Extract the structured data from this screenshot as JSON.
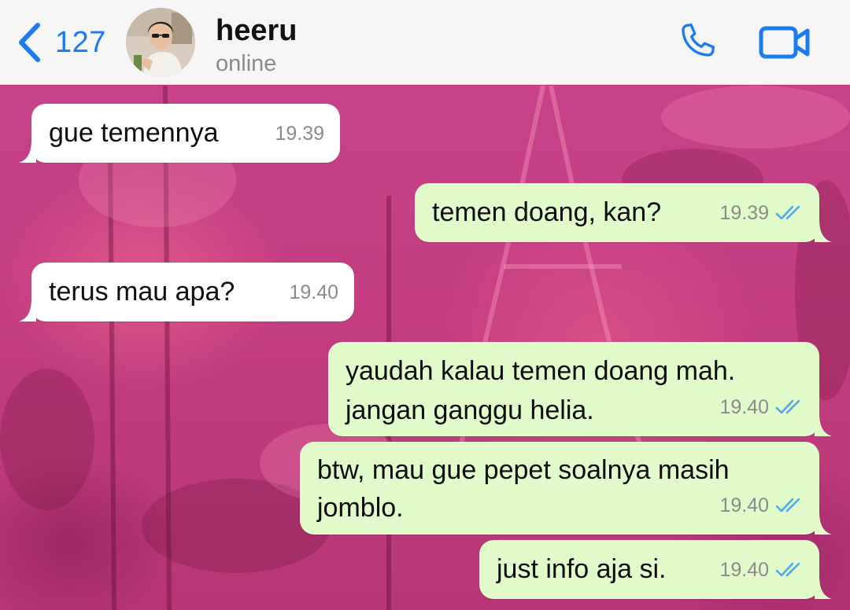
{
  "header": {
    "back_count": "127",
    "contact_name": "heeru",
    "contact_status": "online",
    "call_icon": "phone-icon",
    "video_icon": "video-camera-icon"
  },
  "messages": [
    {
      "direction": "incoming",
      "text": "gue temennya",
      "time": "19.39"
    },
    {
      "direction": "outgoing",
      "text": "temen doang, kan?",
      "time": "19.39",
      "status": "read"
    },
    {
      "direction": "incoming",
      "text": "terus mau apa?",
      "time": "19.40"
    },
    {
      "direction": "outgoing",
      "text": "yaudah kalau temen doang mah. jangan ganggu helia.",
      "time": "19.40",
      "status": "read"
    },
    {
      "direction": "outgoing",
      "text": "btw, mau gue pepet soalnya masih jomblo.",
      "time": "19.40",
      "status": "read"
    },
    {
      "direction": "outgoing",
      "text": "just info aja si.",
      "time": "19.40",
      "status": "read"
    }
  ],
  "colors": {
    "accent": "#1a7cf0",
    "outgoing_bubble": "#e2fbcb",
    "incoming_bubble": "#ffffff",
    "read_check": "#4aa8e8",
    "wallpaper": "#c33d80"
  }
}
